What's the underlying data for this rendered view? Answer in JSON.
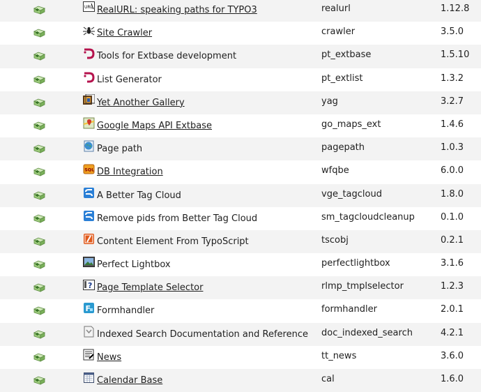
{
  "extensions": [
    {
      "title": "RealURL: speaking paths for TYPO3",
      "key": "realurl",
      "version": "1.12.8",
      "icon": "realurl-icon",
      "linked": true
    },
    {
      "title": "Site Crawler",
      "key": "crawler",
      "version": "3.5.0",
      "icon": "spider-icon",
      "linked": true
    },
    {
      "title": "Tools for Extbase development",
      "key": "pt_extbase",
      "version": "1.5.10",
      "icon": "punkt-logo-icon",
      "linked": false
    },
    {
      "title": "List Generator",
      "key": "pt_extlist",
      "version": "1.3.2",
      "icon": "punkt-logo-icon",
      "linked": false
    },
    {
      "title": "Yet Another Gallery",
      "key": "yag",
      "version": "3.2.7",
      "icon": "gallery-icon",
      "linked": true
    },
    {
      "title": "Google Maps API Extbase",
      "key": "go_maps_ext",
      "version": "1.4.6",
      "icon": "map-icon",
      "linked": true
    },
    {
      "title": "Page path",
      "key": "pagepath",
      "version": "1.0.3",
      "icon": "globe-page-icon",
      "linked": false
    },
    {
      "title": "DB Integration",
      "key": "wfqbe",
      "version": "6.0.0",
      "icon": "sql-icon",
      "linked": true
    },
    {
      "title": "A Better Tag Cloud",
      "key": "vge_tagcloud",
      "version": "1.8.0",
      "icon": "tag-cloud-icon",
      "linked": false
    },
    {
      "title": "Remove pids from Better Tag Cloud",
      "key": "sm_tagcloudcleanup",
      "version": "0.1.0",
      "icon": "tag-cloud-icon",
      "linked": false
    },
    {
      "title": "Content Element From TypoScript",
      "key": "tscobj",
      "version": "0.2.1",
      "icon": "typoscript-icon",
      "linked": false
    },
    {
      "title": "Perfect Lightbox",
      "key": "perfectlightbox",
      "version": "3.1.6",
      "icon": "lightbox-icon",
      "linked": false
    },
    {
      "title": "Page Template Selector",
      "key": "rlmp_tmplselector",
      "version": "1.2.3",
      "icon": "template-question-icon",
      "linked": true
    },
    {
      "title": "Formhandler",
      "key": "formhandler",
      "version": "2.0.1",
      "icon": "form-icon",
      "linked": false
    },
    {
      "title": "Indexed Search Documentation and Reference",
      "key": "doc_indexed_search",
      "version": "4.2.1",
      "icon": "document-icon",
      "linked": false
    },
    {
      "title": "News",
      "key": "tt_news",
      "version": "3.6.0",
      "icon": "news-icon",
      "linked": true
    },
    {
      "title": "Calendar Base",
      "key": "cal",
      "version": "1.6.0",
      "icon": "calendar-icon",
      "linked": true
    }
  ],
  "action_icon": "install-extension-icon",
  "colors": {
    "row_alt": "#f3f3f3",
    "row": "#ffffff",
    "text": "#1f1f1f"
  }
}
